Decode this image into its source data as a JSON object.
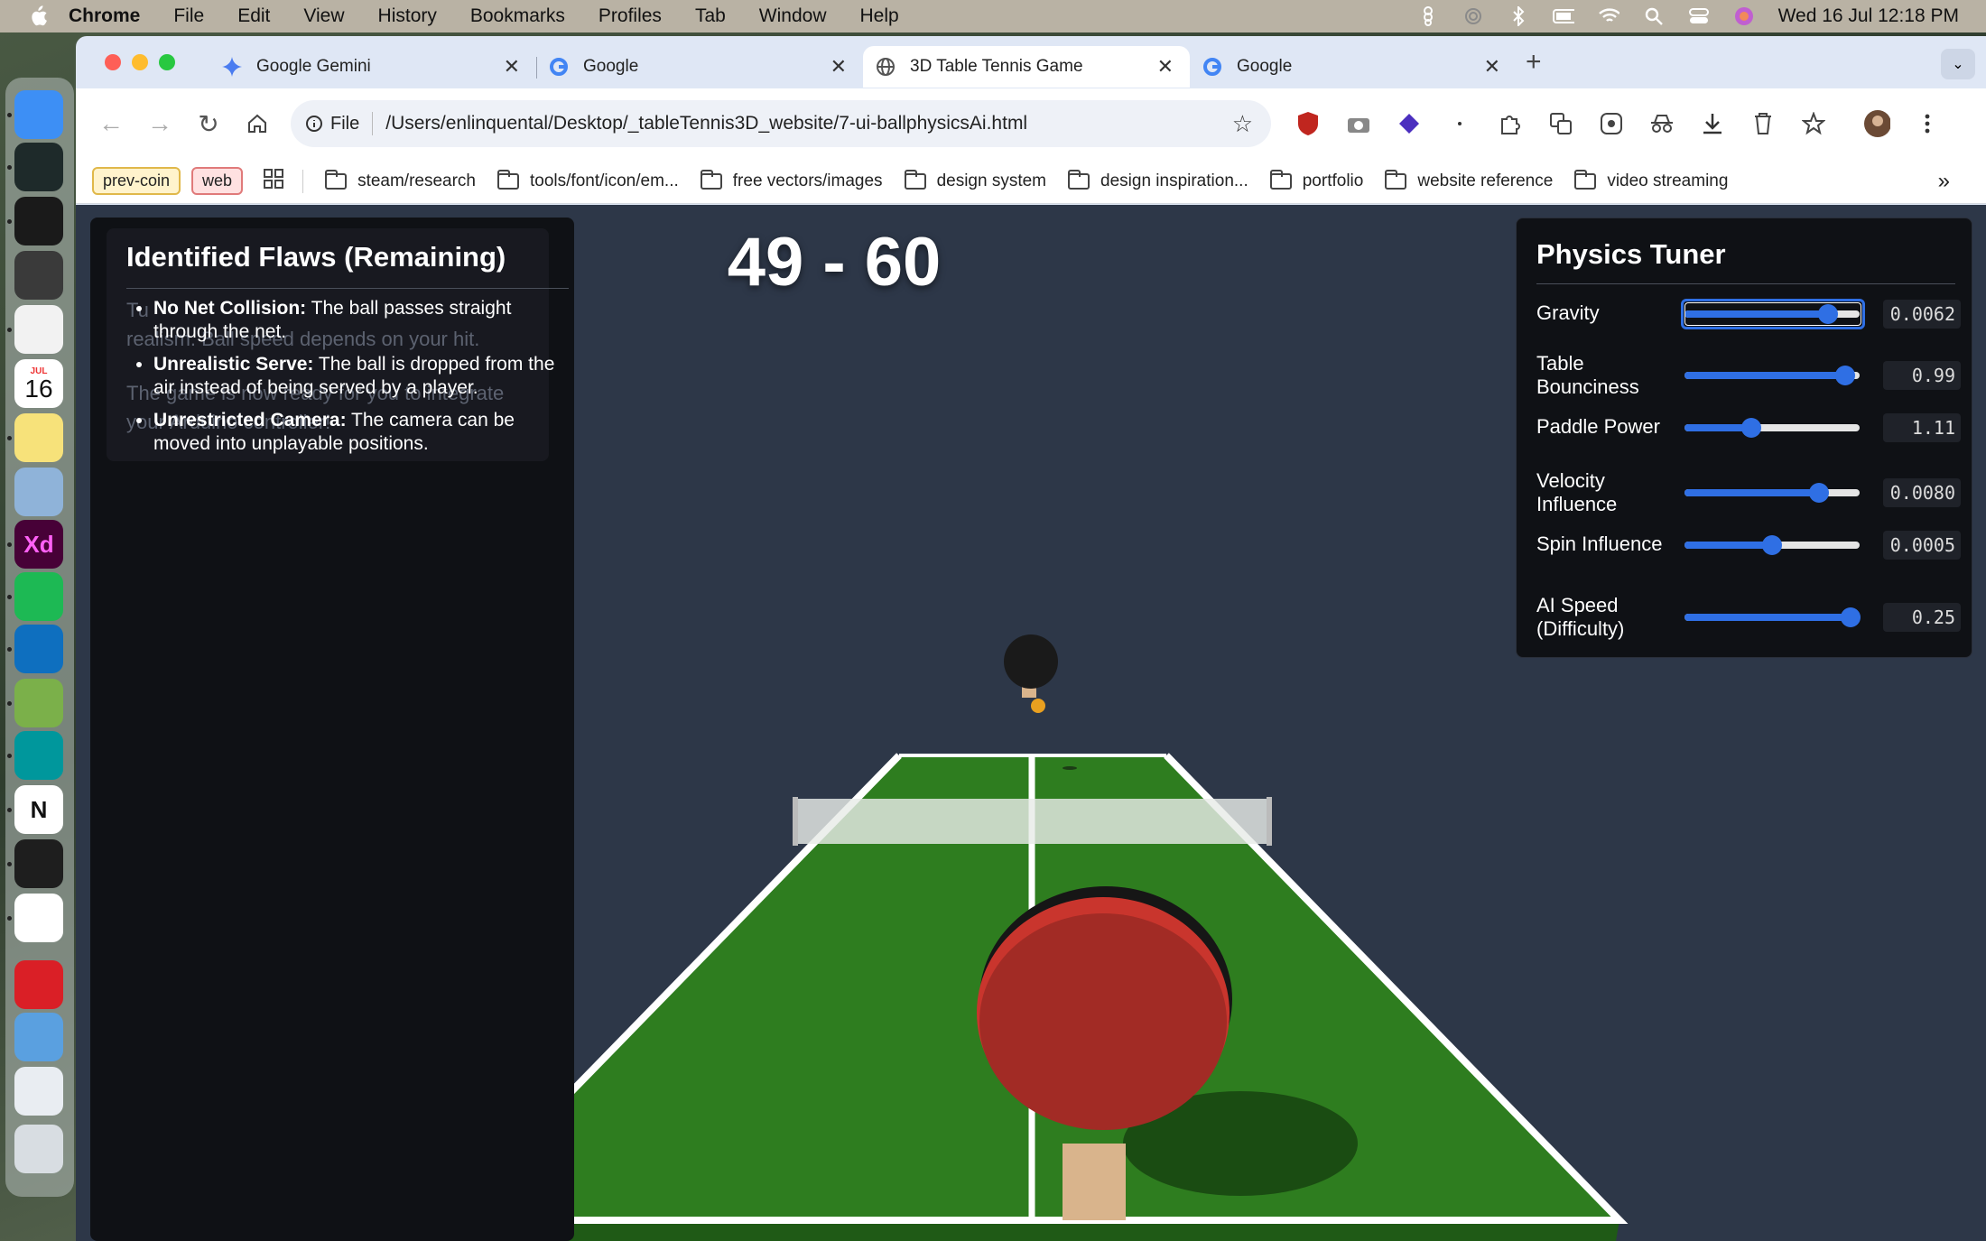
{
  "menubar": {
    "app": "Chrome",
    "items": [
      "File",
      "Edit",
      "View",
      "History",
      "Bookmarks",
      "Profiles",
      "Tab",
      "Window",
      "Help"
    ],
    "clock": "Wed 16 Jul  12:18 PM"
  },
  "dock": {
    "apps": [
      {
        "name": "Finder",
        "color": "#3d8ff5"
      },
      {
        "name": "Activity Monitor",
        "color": "#1e2a2a"
      },
      {
        "name": "Terminal",
        "color": "#1a1a1a"
      },
      {
        "name": "Calculator",
        "color": "#3a3a3a"
      },
      {
        "name": "Photos",
        "color": "#f2f2f2"
      },
      {
        "name": "Calendar",
        "color": "#ffffff",
        "month": "JUL",
        "day": "16"
      },
      {
        "name": "Notes",
        "color": "#f7e27a"
      },
      {
        "name": "Preview",
        "color": "#8fb3d9"
      },
      {
        "name": "Adobe XD",
        "color": "#470137",
        "label": "Xd"
      },
      {
        "name": "Spotify",
        "color": "#1db954"
      },
      {
        "name": "VS Code",
        "color": "#0e6fbf"
      },
      {
        "name": "Script Editor",
        "color": "#7bb04a"
      },
      {
        "name": "Arduino",
        "color": "#00979c"
      },
      {
        "name": "Notion",
        "color": "#ffffff",
        "label": "N"
      },
      {
        "name": "Figma",
        "color": "#1e1e1e"
      },
      {
        "name": "Chrome",
        "color": "#ffffff"
      },
      {
        "name": "Creative Cloud",
        "color": "#da1f26"
      },
      {
        "name": "Downloads",
        "color": "#5aa0e0"
      },
      {
        "name": "Screenshot",
        "color": "#e9edf2"
      },
      {
        "name": "Trash",
        "color": "#d8dde2"
      }
    ]
  },
  "tabs": [
    {
      "title": "Google Gemini",
      "icon": "gemini-icon",
      "active": false
    },
    {
      "title": "Google",
      "icon": "google-icon",
      "active": false
    },
    {
      "title": "3D Table Tennis Game",
      "icon": "globe-icon",
      "active": true
    },
    {
      "title": "Google",
      "icon": "google-icon",
      "active": false
    }
  ],
  "toolbar": {
    "file_label": "File",
    "url": "/Users/enlinquental/Desktop/_tableTennis3D_website/7-ui-ballphysicsAi.html"
  },
  "bookmarks": {
    "chips": [
      {
        "label": "prev-coin",
        "bg": "#fff3cc",
        "border": "#e0b84a"
      },
      {
        "label": "web",
        "bg": "#ffe1e1",
        "border": "#e07a7a"
      }
    ],
    "folders": [
      "steam/research",
      "tools/font/icon/em...",
      "free vectors/images",
      "design system",
      "design inspiration...",
      "portfolio",
      "website reference",
      "video streaming"
    ]
  },
  "game": {
    "score": "49 - 60",
    "flaws": {
      "title": "Identified Flaws (Remaining)",
      "items": [
        {
          "bold": "No Net Collision:",
          "text": " The ball passes straight through the net."
        },
        {
          "bold": "Unrealistic Serve:",
          "text": " The ball is dropped from the air instead of being served by a player."
        },
        {
          "bold": "Unrestricted Camera:",
          "text": " The camera can be moved into unplayable positions."
        }
      ],
      "ghost_lines": [
        "Tu",
        "realism. Ball speed depends on your hit.",
        "The game is now ready for you to integrate",
        "your Arduino controller!"
      ]
    },
    "tuner": {
      "title": "Physics Tuner",
      "rows": [
        {
          "label": "Gravity",
          "value": "0.0062",
          "level": 0.82
        },
        {
          "label": "Table Bounciness",
          "value": "0.99",
          "level": 0.92
        },
        {
          "label": "Paddle Power",
          "value": "1.11",
          "level": 0.38
        },
        {
          "label": "Velocity Influence",
          "value": "0.0080",
          "level": 0.77
        },
        {
          "label": "Spin Influence",
          "value": "0.0005",
          "level": 0.5
        },
        {
          "label": "AI Speed (Difficulty)",
          "value": "0.25",
          "level": 0.95
        }
      ]
    },
    "colors": {
      "table": "#2e7d1f",
      "paddle": "#a22b25",
      "background": "#2d3748",
      "slider": "#2f6fe4"
    }
  }
}
